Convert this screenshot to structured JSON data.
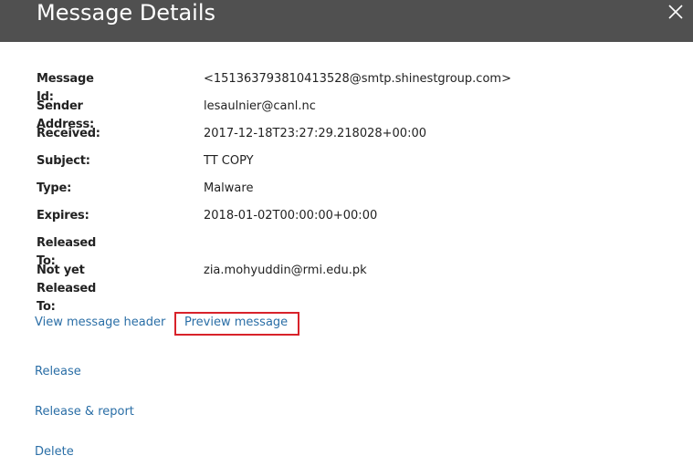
{
  "dialog": {
    "title": "Message Details",
    "close_icon": "close-icon"
  },
  "details": [
    {
      "label": "Message Id:",
      "value": "<151363793810413528@smtp.shinestgroup.com>"
    },
    {
      "label": "Sender Address:",
      "value": "lesaulnier@canl.nc"
    },
    {
      "label": "Received:",
      "value": "2017-12-18T23:27:29.218028+00:00"
    },
    {
      "label": "Subject:",
      "value": "TT COPY"
    },
    {
      "label": "Type:",
      "value": "Malware"
    },
    {
      "label": "Expires:",
      "value": "2018-01-02T00:00:00+00:00"
    },
    {
      "label": "Released To:",
      "value": ""
    },
    {
      "label": "Not yet Released To:",
      "value": "zia.mohyuddin@rmi.edu.pk"
    }
  ],
  "actions": {
    "view_header": "View message header",
    "preview": "Preview message",
    "release": "Release",
    "release_report": "Release & report",
    "delete": "Delete"
  },
  "colors": {
    "header_bg": "#505050",
    "link": "#2a6ea6",
    "highlight": "#d8222a"
  }
}
